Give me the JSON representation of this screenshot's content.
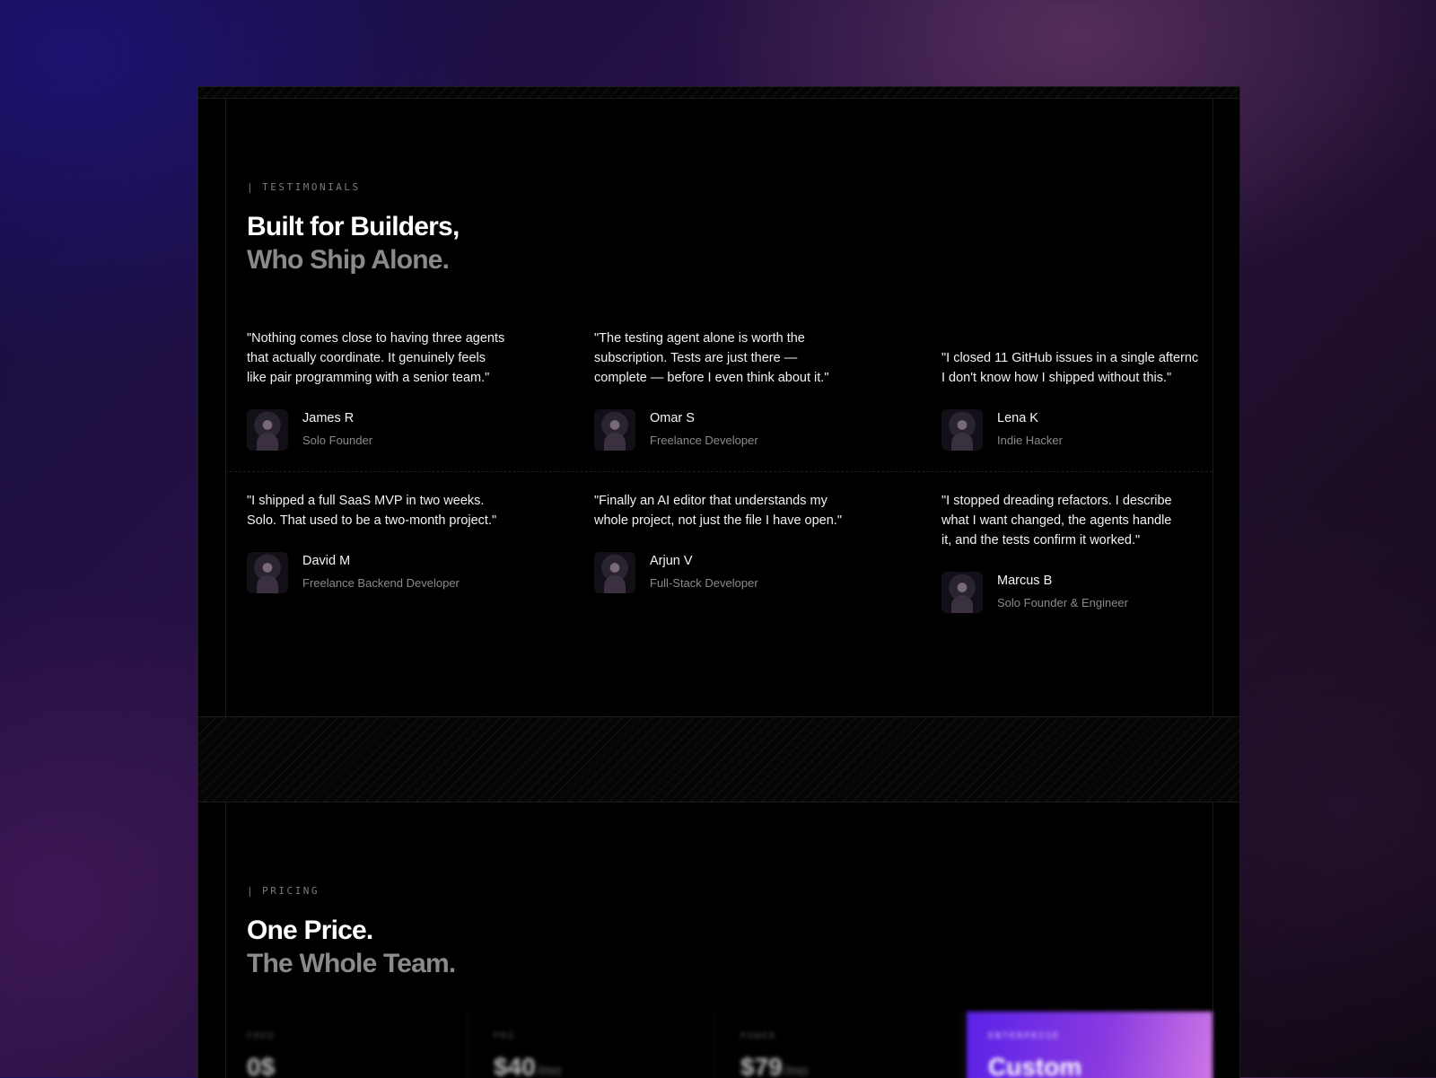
{
  "testimonials": {
    "eyebrow": "TESTIMONIALS",
    "title": "Built for Builders,",
    "subtitle": "Who Ship Alone.",
    "items": [
      {
        "quote": "\"Nothing comes close to having three agents\nthat actually coordinate. It genuinely feels\nlike pair programming with a senior team.\"",
        "name": "James R",
        "role": "Solo Founder"
      },
      {
        "quote": "\"The testing agent alone is worth the\nsubscription. Tests are just there —\ncomplete — before I even think about it.\"",
        "name": "Omar S",
        "role": "Freelance Developer"
      },
      {
        "quote": "\"I closed 11 GitHub issues in a single afternc\nI don't know how I shipped without this.\"",
        "name": "Lena K",
        "role": "Indie Hacker"
      },
      {
        "quote": "\"I shipped a full SaaS MVP in two weeks.\nSolo. That used to be a two-month project.\"",
        "name": "David M",
        "role": "Freelance Backend Developer"
      },
      {
        "quote": "\"Finally an AI editor that understands my\nwhole project, not just the file I have open.\"",
        "name": "Arjun V",
        "role": "Full-Stack Developer"
      },
      {
        "quote": "\"I stopped dreading refactors. I describe\nwhat I want changed, the agents handle\nit, and the tests confirm it worked.\"",
        "name": "Marcus B",
        "role": "Solo Founder & Engineer"
      }
    ]
  },
  "pricing": {
    "eyebrow": "PRICING",
    "title": "One Price.",
    "subtitle": "The Whole Team.",
    "plans": [
      {
        "name": "FREE",
        "price": "0$",
        "unit": ""
      },
      {
        "name": "PRO",
        "price": "$40",
        "unit": "/mo"
      },
      {
        "name": "POWER",
        "price": "$79",
        "unit": "/mo"
      },
      {
        "name": "ENTERPRISE",
        "price": "Custom",
        "unit": ""
      }
    ]
  },
  "colors": {
    "accent_start": "#5a22e8",
    "accent_end": "#d07ae6",
    "background": "#000000"
  }
}
